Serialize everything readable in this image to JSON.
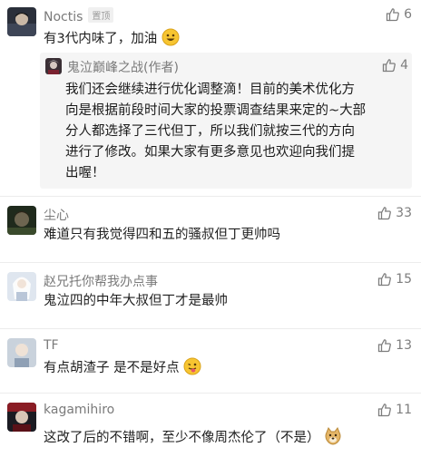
{
  "comments": [
    {
      "username": "Noctis",
      "pinned_label": "置顶",
      "likes": "6",
      "text": "有3代内味了，加油",
      "reply": {
        "username": "鬼泣巅峰之战(作者)",
        "likes": "4",
        "lines": [
          "我们还会继续进行优化调整滴！目前的美术优化方",
          "向是根据前段时间大家的投票调查结果来定的~大部",
          "分人都选择了三代但丁，所以我们就按三代的方向",
          "进行了修改。如果大家有更多意见也欢迎向我们提",
          "出喔！"
        ]
      }
    },
    {
      "username": "尘心",
      "likes": "33",
      "text": "难道只有我觉得四和五的骚叔但丁更帅吗"
    },
    {
      "username": "赵兄托你帮我办点事",
      "likes": "15",
      "text": "鬼泣四的中年大叔但丁才是最帅"
    },
    {
      "username": "TF",
      "likes": "13",
      "text": "有点胡渣子 是不是好点"
    },
    {
      "username": "kagamihiro",
      "likes": "11",
      "text": "这改了后的不错啊，至少不像周杰伦了（不是）"
    }
  ],
  "icons": {
    "like": "thumbs-up-icon"
  },
  "colors": {
    "text": "#1f1f1f",
    "muted": "#7a7a7a",
    "reply_bg": "#f5f5f5"
  }
}
